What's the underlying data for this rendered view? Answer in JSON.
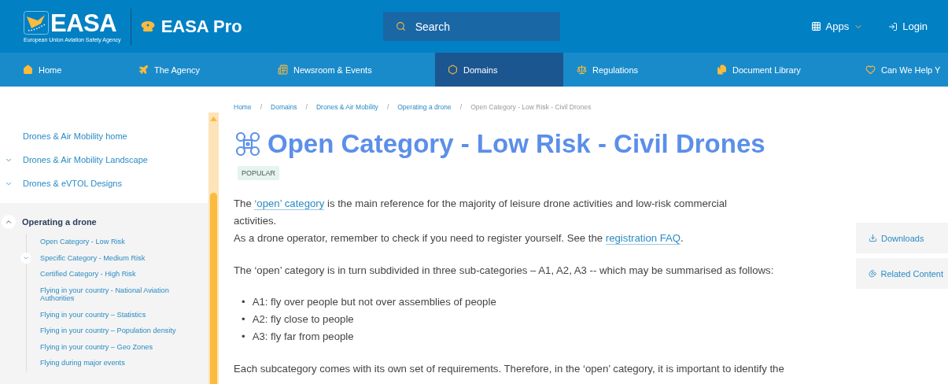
{
  "header": {
    "logo": {
      "wordmark": "EASA",
      "tagline": "European Union Aviation Safety Agency"
    },
    "product": "EASA Pro",
    "search": {
      "placeholder": "Search"
    },
    "apps": "Apps",
    "login": "Login"
  },
  "nav": [
    {
      "label": "Home",
      "selected": false
    },
    {
      "label": "The Agency",
      "selected": false
    },
    {
      "label": "Newsroom & Events",
      "selected": false
    },
    {
      "label": "Domains",
      "selected": true
    },
    {
      "label": "Regulations",
      "selected": false
    },
    {
      "label": "Document Library",
      "selected": false
    },
    {
      "label": "Can We Help Y",
      "selected": false
    }
  ],
  "sidebar": {
    "items": [
      {
        "label": "Drones & Air Mobility home"
      },
      {
        "label": "Drones & Air Mobility Landscape",
        "expanded": false
      },
      {
        "label": "Drones & eVTOL Designs",
        "expanded": false
      },
      {
        "label": "Operating a drone",
        "expanded": true,
        "children": [
          {
            "label": "Open Category - Low Risk"
          },
          {
            "label": "Specific Category - Medium Risk",
            "expanded": false
          },
          {
            "label": "Certified Category - High Risk"
          },
          {
            "label": "Flying in your country - National Aviation Authorities"
          },
          {
            "label": "Flying in your country – Statistics"
          },
          {
            "label": "Flying in your country – Population density"
          },
          {
            "label": "Flying in your country – Geo Zones"
          },
          {
            "label": "Flying during major events"
          }
        ]
      }
    ]
  },
  "breadcrumb": {
    "separator": "/",
    "items": [
      {
        "label": "Home",
        "current": false
      },
      {
        "label": "Domains",
        "current": false
      },
      {
        "label": "Drones & Air Mobility",
        "current": false
      },
      {
        "label": "Operating a drone",
        "current": false
      },
      {
        "label": "Open Category - Low Risk - Civil Drones",
        "current": true
      }
    ]
  },
  "page": {
    "title": "Open Category - Low Risk - Civil Drones",
    "tag": "POPULAR",
    "blocks": [
      {
        "kind": "paragraph",
        "lines": [
          [
            {
              "text": "The ",
              "link": false
            },
            {
              "text": "‘open’ category",
              "link": true
            },
            {
              "text": " is the main reference for the majority of leisure drone activities and low-risk commercial",
              "link": false
            }
          ],
          [
            {
              "text": "activities.",
              "link": false
            }
          ],
          [
            {
              "text": "As a drone operator, remember to check if you need to register yourself. See the ",
              "link": false
            },
            {
              "text": "registration FAQ",
              "link": true
            },
            {
              "text": ".",
              "link": false
            }
          ]
        ]
      },
      {
        "kind": "paragraph",
        "lines": [
          [
            {
              "text": "The ‘open’ category is in turn subdivided in three sub-categories – A1, A2, A3 -- which may be summarised as follows:",
              "link": false
            }
          ]
        ]
      },
      {
        "kind": "list",
        "marker": "•",
        "items": [
          "A1: fly over people but not over assemblies of people",
          "A2: fly close to people",
          "A3: fly far from people"
        ]
      },
      {
        "kind": "paragraph",
        "lines": [
          [
            {
              "text": "Each subcategory comes with its own set of requirements. Therefore, in the ‘open’ category, it is important to identify the",
              "link": false
            }
          ]
        ]
      }
    ]
  },
  "side_actions": [
    {
      "label": "Downloads"
    },
    {
      "label": "Related Content"
    }
  ]
}
